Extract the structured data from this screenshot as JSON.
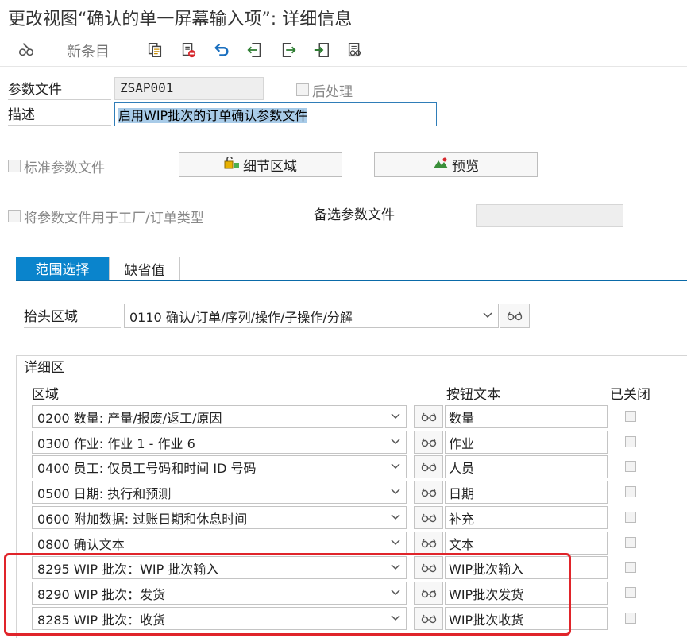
{
  "window": {
    "title": "更改视图“确认的单一屏幕输入项”: 详细信息"
  },
  "toolbar": {
    "new_entry_label": "新条目",
    "icons": [
      "glasses-pencil-icon",
      "copy-icon",
      "delete-icon",
      "undo-icon",
      "prev-entry-icon",
      "next-entry-icon",
      "export-icon",
      "select-all-icon"
    ]
  },
  "header": {
    "profile_label": "参数文件",
    "profile_value": "ZSAP001",
    "postprocess_label": "后处理",
    "description_label": "描述",
    "description_value": "启用WIP批次的订单确认参数文件",
    "standard_profile_label": "标准参数文件",
    "detail_area_button": "细节区域",
    "preview_button": "预览",
    "use_for_plant_label": "将参数文件用于工厂/订单类型",
    "alt_profile_label": "备选参数文件",
    "alt_profile_value": ""
  },
  "tabs": [
    {
      "label": "范围选择",
      "active": true
    },
    {
      "label": "缺省值",
      "active": false
    }
  ],
  "header_area": {
    "label": "抬头区域",
    "value": "0110 确认/订单/序列/操作/子操作/分解"
  },
  "detail_group": {
    "title": "详细区",
    "columns": {
      "area": "区域",
      "button_text": "按钮文本",
      "closed": "已关闭"
    },
    "rows": [
      {
        "area": "0200 数量: 产量/报废/返工/原因",
        "button_text": "数量",
        "closed": false
      },
      {
        "area": "0300 作业: 作业 1 - 作业 6",
        "button_text": "作业",
        "closed": false
      },
      {
        "area": "0400 员工: 仅员工号码和时间 ID 号码",
        "button_text": "人员",
        "closed": false
      },
      {
        "area": "0500 日期: 执行和预测",
        "button_text": "日期",
        "closed": false
      },
      {
        "area": "0600 附加数据: 过账日期和休息时间",
        "button_text": "补充",
        "closed": false
      },
      {
        "area": "0800 确认文本",
        "button_text": "文本",
        "closed": false
      },
      {
        "area": "8295 WIP 批次：WIP 批次输入",
        "button_text": "WIP批次输入",
        "closed": false
      },
      {
        "area": "8290 WIP 批次：发货",
        "button_text": "WIP批次发货",
        "closed": false
      },
      {
        "area": "8285 WIP 批次：收货",
        "button_text": "WIP批次收货",
        "closed": false
      }
    ]
  },
  "colors": {
    "accent": "#0a84cc",
    "highlight_box": "#e0242a"
  }
}
